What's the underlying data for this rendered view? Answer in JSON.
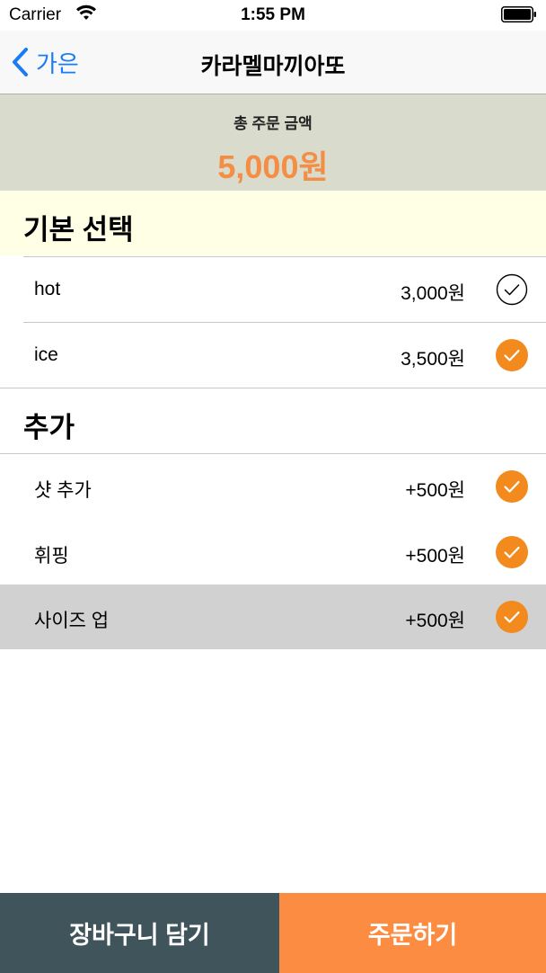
{
  "status_bar": {
    "carrier": "Carrier",
    "time": "1:55 PM"
  },
  "nav": {
    "back_label": "가은",
    "title": "카라멜마끼아또"
  },
  "total": {
    "label": "총 주문 금액",
    "amount": "5,000원"
  },
  "sections": {
    "basic": {
      "title": "기본 선택",
      "items": [
        {
          "name": "hot",
          "price": "3,000원",
          "checked": false
        },
        {
          "name": "ice",
          "price": "3,500원",
          "checked": true
        }
      ]
    },
    "extra": {
      "title": "추가",
      "items": [
        {
          "name": "샷 추가",
          "price": "+500원",
          "checked": true
        },
        {
          "name": "휘핑",
          "price": "+500원",
          "checked": true
        },
        {
          "name": "사이즈 업",
          "price": "+500원",
          "checked": true
        }
      ]
    }
  },
  "buttons": {
    "cart": "장바구니 담기",
    "order": "주문하기"
  },
  "colors": {
    "accent": "#f58e45",
    "check_orange": "#f28a1e",
    "link_blue": "#1a7cf5",
    "cart_button": "#3f545b",
    "order_button": "#fd8c43"
  }
}
